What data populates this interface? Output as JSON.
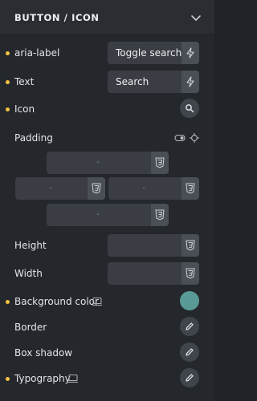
{
  "header": {
    "title": "BUTTON / ICON"
  },
  "rows": {
    "aria_label": {
      "label": "aria-label",
      "value": "Toggle search"
    },
    "text": {
      "label": "Text",
      "value": "Search"
    },
    "icon": {
      "label": "Icon"
    },
    "padding": {
      "label": "Padding"
    },
    "height": {
      "label": "Height"
    },
    "width": {
      "label": "Width"
    },
    "background_color": {
      "label": "Background color",
      "color": "#5a9a96"
    },
    "border": {
      "label": "Border"
    },
    "box_shadow": {
      "label": "Box shadow"
    },
    "typography": {
      "label": "Typography"
    }
  },
  "padding_placeholder": "-",
  "colors": {
    "accent_dot": "#f5c542",
    "panel": "#24272c",
    "field": "#3a3e44"
  },
  "icons": [
    "chevron-down-icon",
    "lightning-icon",
    "search-icon",
    "toggle-icon",
    "crosshair-icon",
    "css3-icon",
    "monitor-icon",
    "pencil-icon"
  ]
}
